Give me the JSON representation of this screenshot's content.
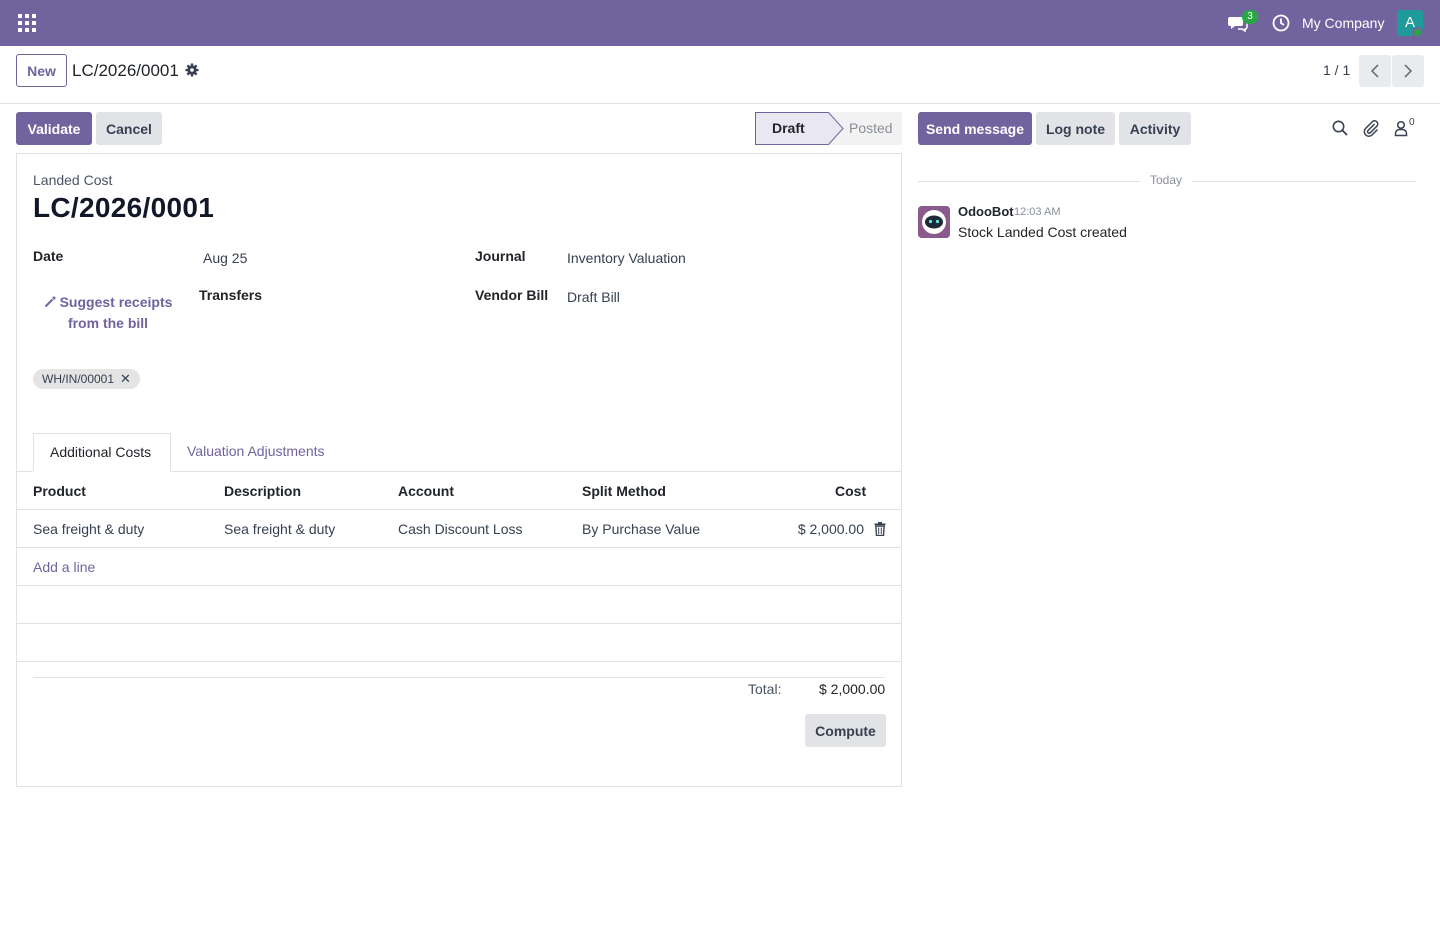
{
  "navbar": {
    "company": "My Company",
    "messages_count": "3",
    "avatar_letter": "A"
  },
  "control": {
    "new_label": "New",
    "title": "LC/2026/0001",
    "pager": "1 / 1"
  },
  "actions": {
    "validate": "Validate",
    "cancel": "Cancel"
  },
  "statusbar": {
    "stages": [
      "Draft",
      "Posted"
    ],
    "current": "Draft"
  },
  "form": {
    "type_label": "Landed Cost",
    "name": "LC/2026/0001",
    "date_label": "Date",
    "date_value": "Aug 25",
    "journal_label": "Journal",
    "journal_value": "Inventory Valuation",
    "transfers_label": "Transfers",
    "vendor_bill_label": "Vendor Bill",
    "vendor_bill_value": "Draft Bill",
    "suggest_label": "Suggest receipts from the bill",
    "transfer_tag": "WH/IN/00001"
  },
  "tabs": [
    "Additional Costs",
    "Valuation Adjustments"
  ],
  "table": {
    "headers": [
      "Product",
      "Description",
      "Account",
      "Split Method",
      "Cost"
    ],
    "rows": [
      {
        "product": "Sea freight & duty",
        "description": "Sea freight & duty",
        "account": "Cash Discount Loss",
        "split_method": "By Purchase Value",
        "cost": "$ 2,000.00"
      }
    ],
    "add_line": "Add a line"
  },
  "totals": {
    "label": "Total:",
    "value": "$ 2,000.00",
    "compute": "Compute"
  },
  "chatter": {
    "send_message": "Send message",
    "log_note": "Log note",
    "activity": "Activity",
    "followers_count": "0",
    "date_separator": "Today",
    "messages": [
      {
        "author": "OdooBot",
        "time": "12:03 AM",
        "body": "Stock Landed Cost created"
      }
    ]
  },
  "colors": {
    "brand": "#71639e",
    "badge": "#28a745",
    "avatar": "#1f9a9a"
  }
}
